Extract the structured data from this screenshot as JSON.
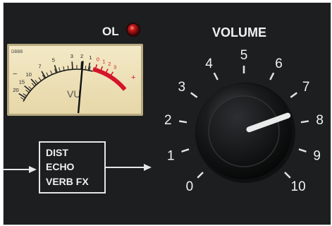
{
  "overload": {
    "label": "OL",
    "led_color": "#9b1010"
  },
  "volume": {
    "label": "VOLUME",
    "value": 7.6,
    "min": 0,
    "max": 10,
    "scale_labels": [
      "0",
      "1",
      "2",
      "3",
      "4",
      "5",
      "6",
      "7",
      "8",
      "9",
      "10"
    ]
  },
  "vu_meter": {
    "brand": "DBBB",
    "label": "VU",
    "scale_labels": [
      "20",
      "15",
      "10",
      "7",
      "5",
      "3",
      "2",
      "1",
      "0",
      "1",
      "2",
      "3"
    ],
    "minus_sign": "−",
    "plus_sign": "+",
    "needle_value_db": 0,
    "face_color": "#efe3bd",
    "red_zone_color": "#d4142a"
  },
  "effects_block": {
    "lines": [
      "DIST",
      "ECHO",
      "VERB FX"
    ]
  },
  "colors": {
    "panel": "#1c1e1f",
    "text": "#f2f2f2",
    "knob": "#101112",
    "knob_pointer": "#e9ecea"
  }
}
